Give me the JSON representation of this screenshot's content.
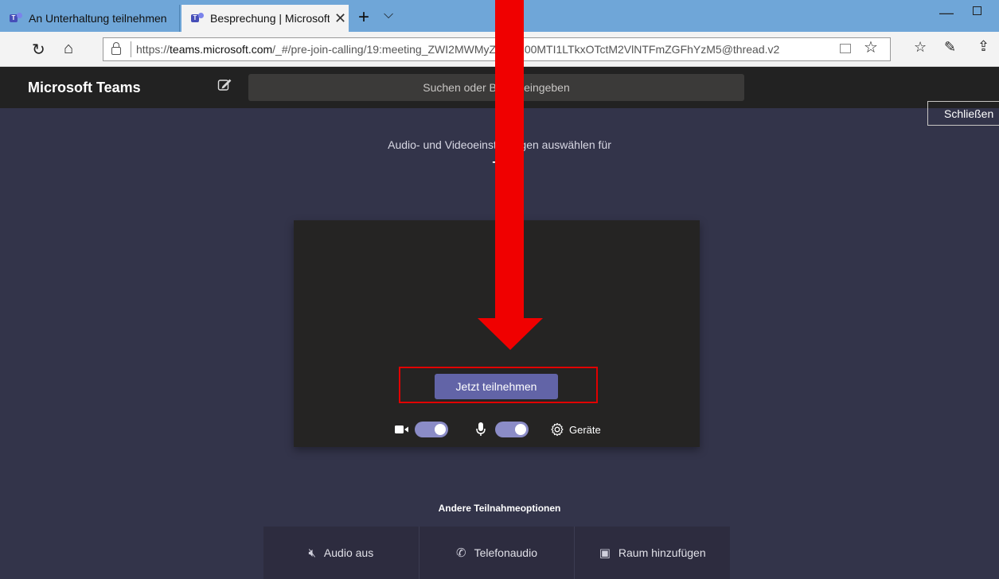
{
  "browser": {
    "tabs": [
      {
        "title": "An Unterhaltung teilnehmen"
      },
      {
        "title": "Besprechung | Microsoft Teams",
        "close": "✕"
      }
    ],
    "new_tab": "+",
    "tab_list": "⌵",
    "window_min": "—",
    "url_prefix": "https://",
    "url_domain": "teams.microsoft.com",
    "url_path": "/_#/pre-join-calling/19:meeting_ZWI2MWMyZ",
    "url_path_end": "/ZiNC00MTI1LTkxOTctM2VlNTFmZGFhYzM5@thread.v2"
  },
  "teams": {
    "app_title": "Microsoft Teams",
    "search_placeholder": "Suchen oder Befehl eingeben",
    "close_button": "Schließen",
    "subtitle": "Audio- und Videoeinstellungen auswählen für",
    "meeting_name": "Te",
    "join_button": "Jetzt teilnehmen",
    "video_toggle": "on",
    "mic_toggle": "on",
    "devices_label": "Geräte",
    "other_options_title": "Andere Teilnahmeoptionen",
    "options": [
      {
        "label": "Audio aus",
        "icon": "speaker-off-icon"
      },
      {
        "label": "Telefonaudio",
        "icon": "phone-icon"
      },
      {
        "label": "Raum hinzufügen",
        "icon": "cast-icon"
      }
    ]
  },
  "annotation": {
    "arrow_color": "#f00000",
    "box_color": "#e10000"
  }
}
